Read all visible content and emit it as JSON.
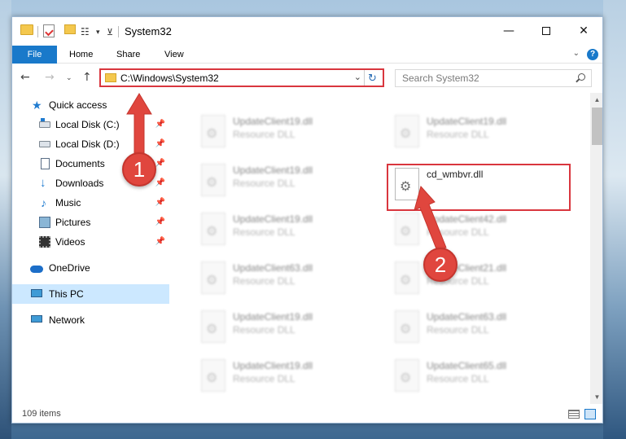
{
  "window": {
    "title": "System32",
    "ribbon_tabs": [
      "File",
      "Home",
      "Share",
      "View"
    ]
  },
  "address": {
    "path": "C:\\Windows\\System32",
    "search_placeholder": "Search System32"
  },
  "nav_pane": {
    "items": [
      {
        "label": "Quick access",
        "icon": "star-icon"
      },
      {
        "label": "Local Disk (C:)",
        "icon": "drive-c-icon",
        "pinned": true
      },
      {
        "label": "Local Disk (D:)",
        "icon": "drive-d-icon",
        "pinned": true
      },
      {
        "label": "Documents",
        "icon": "documents-icon",
        "pinned": true
      },
      {
        "label": "Downloads",
        "icon": "downloads-icon",
        "pinned": true
      },
      {
        "label": "Music",
        "icon": "music-icon",
        "pinned": true
      },
      {
        "label": "Pictures",
        "icon": "pictures-icon",
        "pinned": true
      },
      {
        "label": "Videos",
        "icon": "videos-icon",
        "pinned": true
      },
      {
        "label": "OneDrive",
        "icon": "onedrive-icon"
      },
      {
        "label": "This PC",
        "icon": "this-pc-icon",
        "selected": true
      },
      {
        "label": "Network",
        "icon": "network-icon"
      }
    ]
  },
  "files": {
    "left_column": [
      {
        "name": "UpdateClient19.dll",
        "type": "Resource DLL"
      },
      {
        "name": "UpdateClient19.dll",
        "type": "Resource DLL"
      },
      {
        "name": "UpdateClient19.dll",
        "type": "Resource DLL"
      },
      {
        "name": "UpdateClient63.dll",
        "type": "Resource DLL"
      },
      {
        "name": "UpdateClient19.dll",
        "type": "Resource DLL"
      },
      {
        "name": "UpdateClient19.dll",
        "type": "Resource DLL"
      }
    ],
    "right_column": [
      {
        "name": "UpdateClient19.dll",
        "type": "Resource DLL"
      },
      {
        "name": "cd_wmbvr.dll",
        "type": "",
        "highlighted": true
      },
      {
        "name": "UpdateClient42.dll",
        "type": "Resource DLL"
      },
      {
        "name": "UpdateClient21.dll",
        "type": "Resource DLL"
      },
      {
        "name": "UpdateClient63.dll",
        "type": "Resource DLL"
      },
      {
        "name": "UpdateClient65.dll",
        "type": "Resource DLL"
      }
    ]
  },
  "status": {
    "item_count": "109 items"
  },
  "annotations": {
    "badge_1": "1",
    "badge_2": "2",
    "color": "#e0463e"
  }
}
